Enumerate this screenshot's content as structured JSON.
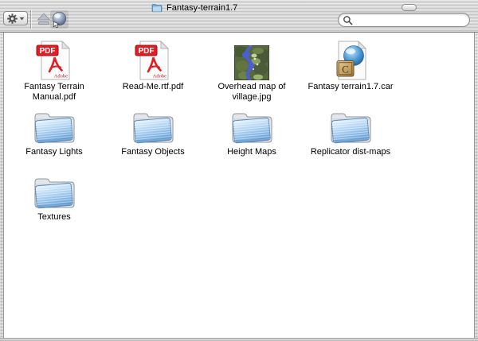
{
  "window": {
    "title": "Fantasy-terrain1.7"
  },
  "toolbar": {
    "action_button_icon": "gear-icon",
    "eject_icon": "eject-icon",
    "sphere_icon": "sphere-cursor-icon",
    "search": {
      "value": "",
      "placeholder": ""
    }
  },
  "icons": {
    "pdf_badge": "PDF",
    "pdf_brand": "Adobe",
    "car_letter": "C",
    "colors": {
      "pdf_red": "#e31b23",
      "folder_blue": "#8fc0e9",
      "metal_gray": "#cccccc",
      "map_green": "#57683f",
      "river_blue": "#4a5fd0",
      "car_gold": "#c9a05a"
    }
  },
  "items": [
    {
      "type": "pdf",
      "lines": [
        "Fantasy Terrain Manual.pdf"
      ]
    },
    {
      "type": "pdf",
      "lines": [
        "Read-Me.rtf.pdf"
      ]
    },
    {
      "type": "image",
      "lines": [
        "Overhead map of",
        "village.jpg"
      ]
    },
    {
      "type": "car",
      "lines": [
        "Fantasy terrain1.7.car"
      ]
    },
    {
      "type": "folder",
      "lines": [
        "Fantasy Lights"
      ]
    },
    {
      "type": "folder",
      "lines": [
        "Fantasy Objects"
      ]
    },
    {
      "type": "folder",
      "lines": [
        "Height Maps"
      ]
    },
    {
      "type": "folder",
      "lines": [
        "Replicator dist-maps"
      ]
    },
    {
      "type": "folder",
      "lines": [
        "Textures"
      ]
    }
  ]
}
